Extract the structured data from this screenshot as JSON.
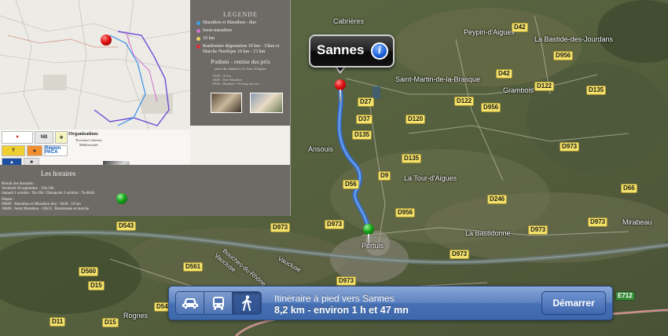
{
  "callout": {
    "label": "Sannes",
    "info_icon": "info-icon"
  },
  "navbar": {
    "modes": [
      {
        "name": "car-icon",
        "active": false
      },
      {
        "name": "bus-icon",
        "active": false
      },
      {
        "name": "walk-icon",
        "active": true
      }
    ],
    "title": "Itinéraire à pied vers Sannes",
    "subtitle": "8,2 km - environ 1 h et 47 mn",
    "start_label": "Démarrer"
  },
  "map": {
    "places": {
      "cabrieres": "Cabrières",
      "peypin": "Peypin-d'Aigues",
      "bastide": "La Bastide-des-Jourdans",
      "grambois": "Grambois",
      "saint_martin": "Saint-Martin-de-la-Brasque",
      "ansouis": "Ansouis",
      "tour_aigues": "La Tour-d'Aigues",
      "pertuis": "Pertuis",
      "bastidonne": "La Bastidonne",
      "mirabeau": "Mirabeau",
      "rognes": "Rognes",
      "bouches": "Bouches-du-Rhône",
      "vaucluse": "Vaucluse",
      "vaucluse2": "Vaucluse"
    },
    "roads": {
      "d42_top": "D42",
      "d42": "D42",
      "d956_top": "D956",
      "d122a": "D122",
      "d122b": "D122",
      "d135_top": "D135",
      "d956_mid": "D956",
      "d27": "D27",
      "d120": "D120",
      "d37": "D37",
      "d135": "D135",
      "d973_right": "D973",
      "d135_mid": "D135",
      "d9": "D9",
      "d56": "D56",
      "d246": "D246",
      "d956_low": "D956",
      "d973": "D973",
      "d543": "D543",
      "d973_low": "D973",
      "d560": "D560",
      "d561": "D561",
      "d973_bot": "D973",
      "d15": "D15",
      "d15_b": "D15",
      "d973_br": "D973",
      "d973_far": "D973",
      "e712": "E712",
      "d11": "D11",
      "d543_b": "D543",
      "d973_mid": "D973",
      "d66": "D66"
    }
  },
  "poster": {
    "legend_title": "LEGENDE",
    "legend_items": [
      {
        "color": "#3aa0e8",
        "text": "Marathon et Marathon - duo"
      },
      {
        "color": "#d070d0",
        "text": "Semi-marathon"
      },
      {
        "color": "#e8d060",
        "text": "10 km"
      },
      {
        "color": "#e03030",
        "text": "Randonnée dégustation 10 km - 15km et Marche Nordique 10 km - 15 km"
      }
    ],
    "podium_title": "Podium - remise des prix",
    "podium_sub": "place du château à La Tour d'Aigues",
    "podium_lines": [
      "15h30 : 10 Km",
      "16h00 : Semi-Marathon",
      "16h30 : Marathon / l'échange du rosé…"
    ],
    "org_title": "Organisation:",
    "org_text": "Provence Luberon Méditerranée",
    "sponsor_region": "Région PACA",
    "horaires_title": "Les horaires",
    "horaires_lines": [
      "Retrait des dossards :",
      "Vendredi 30 septembre : 15h-19h",
      "Samedi 1 octobre : 9h-19h / Dimanche 2 octobre : 7h-8h30",
      "Départ :",
      "09h00 : Marathon et Marathon duo - 9h30 : 10 km",
      "10h00 : Semi Marathon - 10h15 : Randonnée et marche"
    ]
  }
}
